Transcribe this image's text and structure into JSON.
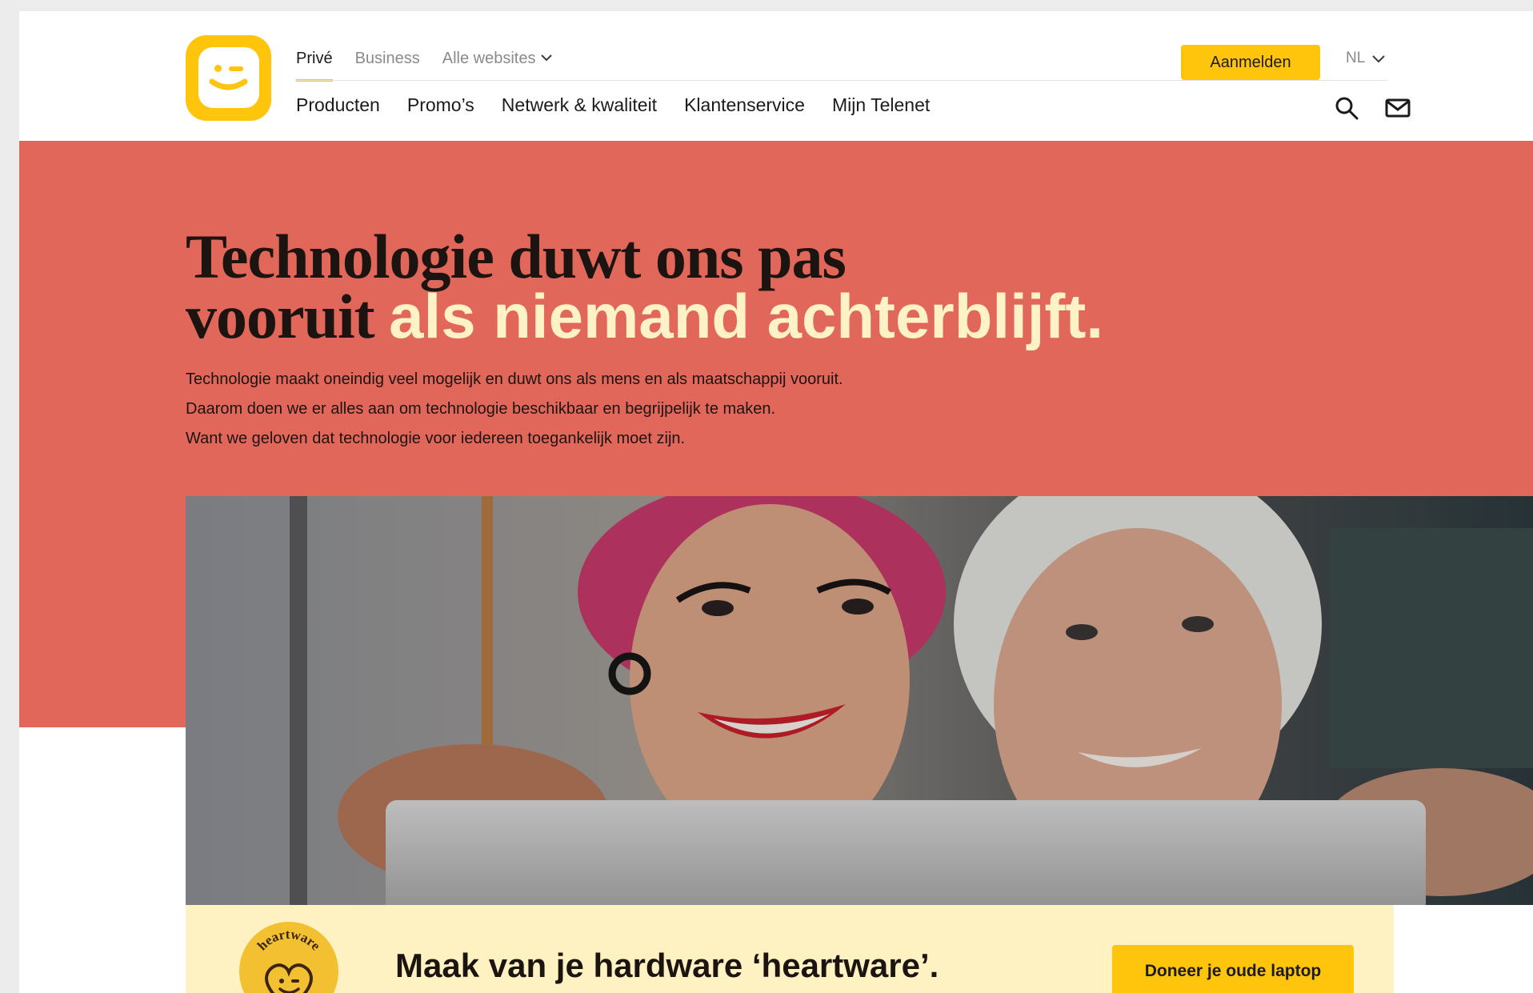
{
  "header": {
    "logo_icon": "telenet-smiley-logo-icon",
    "top_nav": [
      {
        "label": "Privé",
        "active": true
      },
      {
        "label": "Business",
        "active": false
      },
      {
        "label": "Alle websites",
        "active": false,
        "icon": "chevron-down-icon"
      }
    ],
    "login_label": "Aanmelden",
    "language": "NL",
    "main_nav": [
      "Producten",
      "Promo’s",
      "Netwerk & kwaliteit",
      "Klantenservice",
      "Mijn Telenet"
    ],
    "icons": [
      "search-icon",
      "mail-icon"
    ]
  },
  "hero": {
    "headline_dark_1": "Technologie duwt ons pas",
    "headline_dark_2": "vooruit",
    "headline_accent": "als niemand achterblijft.",
    "intro_lines": [
      "Technologie maakt oneindig veel mogelijk en duwt ons als mens en als maatschappij vooruit.",
      "Daarom doen we er alles aan om technologie beschikbaar en begrijpelijk te maken.",
      "Want we geloven dat technologie voor iedereen toegankelijk moet zijn."
    ],
    "photo": "two-women-taking-selfie-with-tablet"
  },
  "banner": {
    "badge_text": "heartware",
    "title": "Maak van je hardware ‘heartware’.",
    "cta_label": "Doneer je oude laptop"
  },
  "colors": {
    "brand_yellow": "#ffc40c",
    "hero_coral": "#e2675b",
    "accent_cream": "#fff2c7",
    "banner_cream": "#fff2c2",
    "text_dark": "#1c1410"
  }
}
